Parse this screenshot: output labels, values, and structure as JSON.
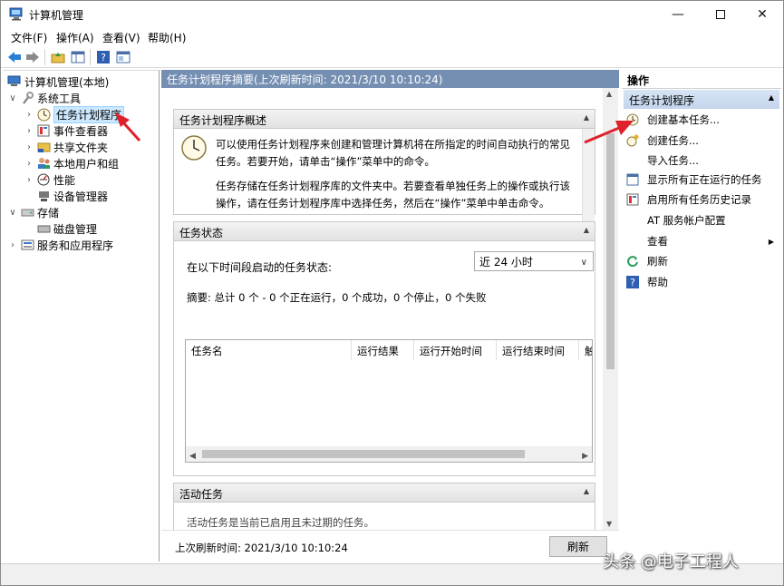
{
  "window": {
    "title": "计算机管理",
    "controls": [
      "minimize",
      "maximize",
      "close"
    ]
  },
  "menu": [
    "文件(F)",
    "操作(A)",
    "查看(V)",
    "帮助(H)"
  ],
  "toolbar_icons": [
    "back-icon",
    "forward-icon",
    "up-folder-icon",
    "show-hide-tree-icon",
    "help-icon",
    "properties-icon"
  ],
  "tree": {
    "root": "计算机管理(本地)",
    "system_tools": "系统工具",
    "task_scheduler": "任务计划程序",
    "event_viewer": "事件查看器",
    "shared_folders": "共享文件夹",
    "local_users": "本地用户和组",
    "performance": "性能",
    "device_manager": "设备管理器",
    "storage": "存储",
    "disk_management": "磁盘管理",
    "services_apps": "服务和应用程序"
  },
  "center": {
    "header": "任务计划程序摘要(上次刷新时间: 2021/3/10 10:10:24)",
    "overview": {
      "title": "任务计划程序概述",
      "para1": "可以使用任务计划程序来创建和管理计算机将在所指定的时间自动执行的常见任务。若要开始，请单击“操作”菜单中的命令。",
      "para2": "任务存储在任务计划程序库的文件夹中。若要查看单独任务上的操作或执行该操作，请在任务计划程序库中选择任务，然后在“操作”菜单中单击命令。"
    },
    "status": {
      "title": "任务状态",
      "label": "在以下时间段启动的任务状态:",
      "period": "近 24 小时",
      "summary": "摘要: 总计 0 个 - 0 个正在运行，0 个成功，0 个停止，0 个失败",
      "columns": [
        "任务名",
        "运行结果",
        "运行开始时间",
        "运行结束时间",
        "触"
      ]
    },
    "active": {
      "title": "活动任务",
      "partial": "活动任务是当前已启用且未过期的任务。"
    },
    "last_refresh": "上次刷新时间: 2021/3/10 10:10:24",
    "refresh_button": "刷新"
  },
  "actions": {
    "title": "操作",
    "group": "任务计划程序",
    "items": [
      {
        "label": "创建基本任务...",
        "icon": "create-basic-task-icon"
      },
      {
        "label": "创建任务...",
        "icon": "create-task-icon"
      },
      {
        "label": "导入任务...",
        "icon": ""
      },
      {
        "label": "显示所有正在运行的任务",
        "icon": "running-tasks-icon"
      },
      {
        "label": "启用所有任务历史记录",
        "icon": "history-icon"
      },
      {
        "label": "AT 服务帐户配置",
        "icon": ""
      },
      {
        "label": "查看",
        "icon": ""
      },
      {
        "label": "刷新",
        "icon": "refresh-icon"
      },
      {
        "label": "帮助",
        "icon": "help-icon"
      }
    ]
  },
  "watermark": "头条 @电子工程人",
  "colors": {
    "header_bg": "#748fb2",
    "selection": "#cce8ff",
    "action_group_bg": "#c9d9ef",
    "annotation_arrow": "#e0202a"
  }
}
